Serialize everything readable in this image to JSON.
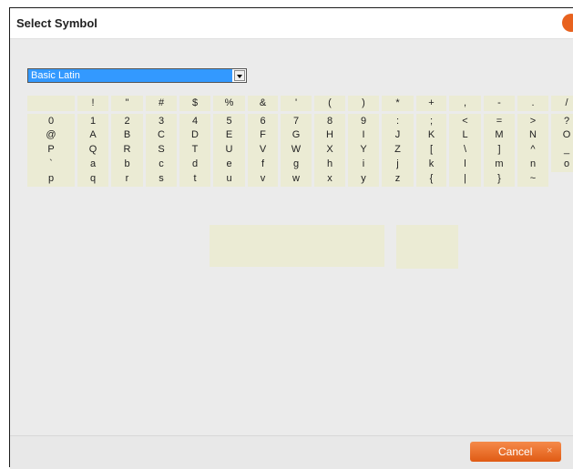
{
  "dialog": {
    "title": "Select Symbol",
    "close_icon": "close-icon"
  },
  "charset_select": {
    "selected": "Basic Latin"
  },
  "symbols": {
    "rows": [
      [
        " ",
        "!",
        "\"",
        "#",
        "$",
        "%",
        "&",
        "'",
        "(",
        ")",
        "*",
        "+",
        ",",
        "-",
        ".",
        "/"
      ],
      [
        "0",
        "1",
        "2",
        "3",
        "4",
        "5",
        "6",
        "7",
        "8",
        "9",
        ":",
        ";",
        "<",
        "=",
        ">",
        "?"
      ],
      [
        "@",
        "A",
        "B",
        "C",
        "D",
        "E",
        "F",
        "G",
        "H",
        "I",
        "J",
        "K",
        "L",
        "M",
        "N",
        "O"
      ],
      [
        "P",
        "Q",
        "R",
        "S",
        "T",
        "U",
        "V",
        "W",
        "X",
        "Y",
        "Z",
        "[",
        "\\",
        "]",
        "^",
        "_"
      ],
      [
        "`",
        "a",
        "b",
        "c",
        "d",
        "e",
        "f",
        "g",
        "h",
        "i",
        "j",
        "k",
        "l",
        "m",
        "n",
        "o"
      ],
      [
        "p",
        "q",
        "r",
        "s",
        "t",
        "u",
        "v",
        "w",
        "x",
        "y",
        "z",
        "{",
        "|",
        "}",
        "~"
      ]
    ]
  },
  "footer": {
    "cancel_label": "Cancel",
    "cancel_icon": "×"
  },
  "colors": {
    "accent": "#e8621e",
    "cell_bg": "#ebebd4",
    "selection": "#3399ff"
  }
}
